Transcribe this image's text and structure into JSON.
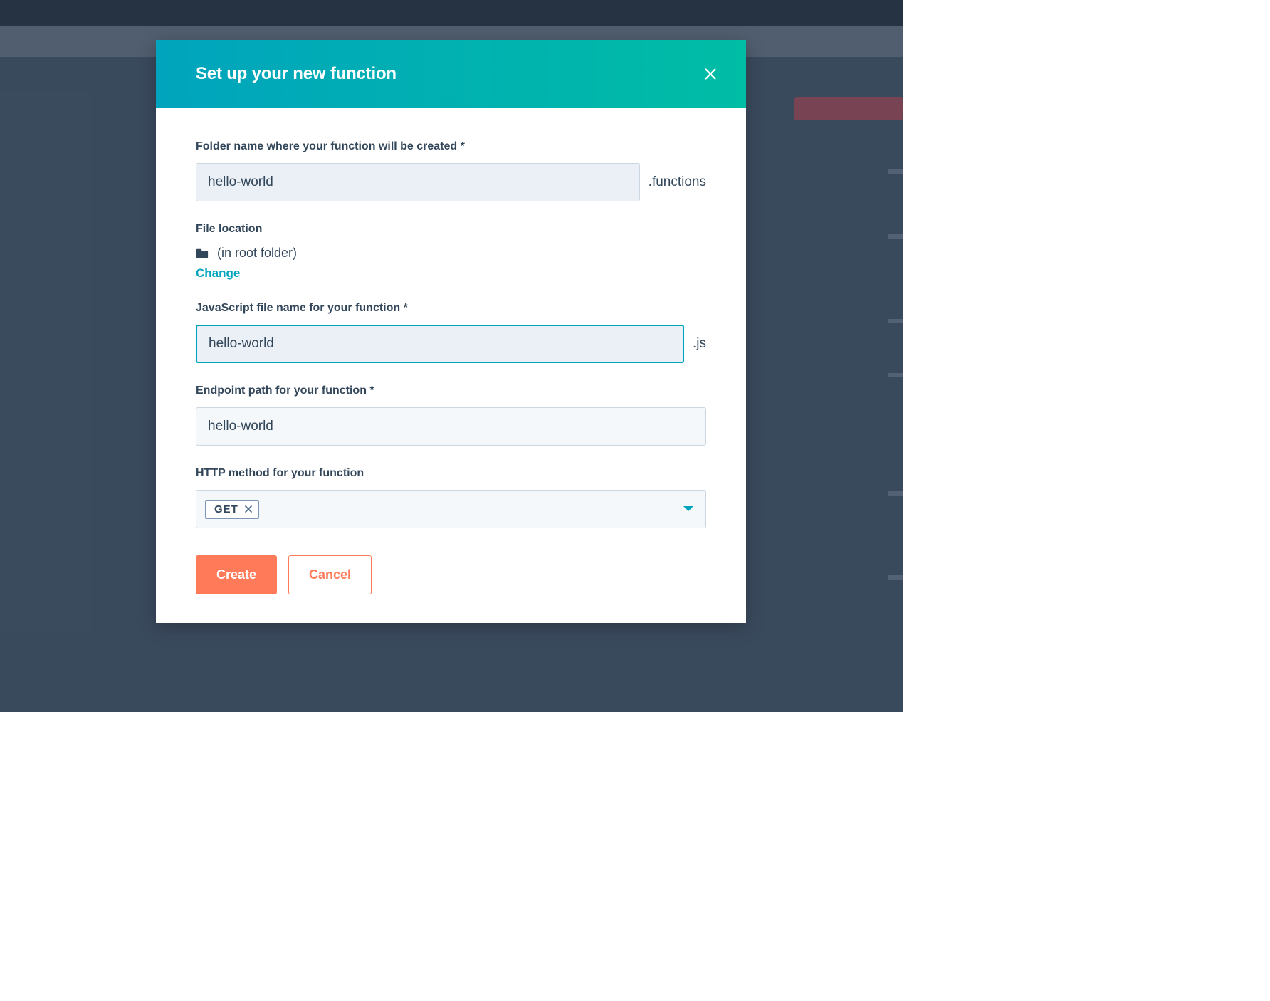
{
  "modal": {
    "title": "Set up your new function",
    "folder": {
      "label": "Folder name where your function will be created *",
      "value": "hello-world",
      "suffix": ".functions"
    },
    "fileLocation": {
      "label": "File location",
      "path": "(in root folder)",
      "changeLink": "Change"
    },
    "jsFile": {
      "label": "JavaScript file name for your function *",
      "value": "hello-world",
      "suffix": ".js"
    },
    "endpoint": {
      "label": "Endpoint path for your function *",
      "value": "hello-world"
    },
    "httpMethod": {
      "label": "HTTP method for your function",
      "selected": "GET"
    },
    "buttons": {
      "create": "Create",
      "cancel": "Cancel"
    }
  }
}
